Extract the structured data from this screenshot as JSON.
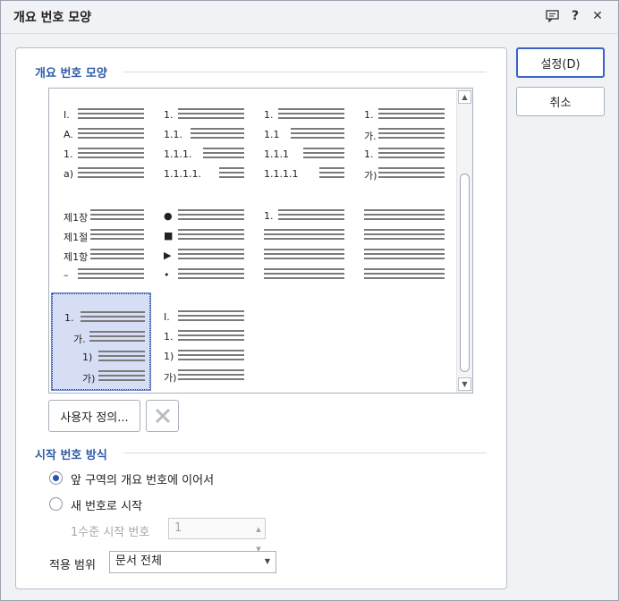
{
  "window": {
    "title": "개요 번호 모양"
  },
  "titlebar_icons": [
    {
      "name": "comment-icon",
      "glyph": "🗨"
    },
    {
      "name": "help-icon",
      "glyph": "?"
    },
    {
      "name": "close-icon",
      "glyph": "✕"
    }
  ],
  "outline_section": {
    "label": "개요 번호 모양"
  },
  "presets": [
    {
      "labels": [
        "I.",
        "A.",
        "1.",
        "a)"
      ]
    },
    {
      "labels": [
        "1.",
        "1.1.",
        "1.1.1.",
        "1.1.1.1."
      ]
    },
    {
      "labels": [
        "1.",
        "1.1",
        "1.1.1",
        "1.1.1.1"
      ]
    },
    {
      "labels": [
        "1.",
        "가.",
        "1.",
        "가)"
      ]
    },
    {
      "labels": [
        "제1장",
        "제1절",
        "제1항",
        "–"
      ]
    },
    {
      "labels": [
        "●",
        "■",
        "▶",
        "•"
      ]
    },
    {
      "labels": [
        "1.",
        "",
        "",
        ""
      ]
    },
    {
      "labels": [
        "",
        "",
        "",
        ""
      ]
    },
    {
      "labels": [
        "1.",
        "가.",
        "1)",
        "가)"
      ],
      "selected": true
    },
    {
      "labels": [
        "I.",
        "1.",
        "1)",
        "가)"
      ]
    }
  ],
  "custom_button": {
    "label": "사용자 정의..."
  },
  "delete_icon": "delete-x-icon",
  "start_section": {
    "label": "시작 번호 방식"
  },
  "radio_continue": {
    "label": "앞 구역의 개요 번호에 이어서",
    "checked": true
  },
  "radio_new": {
    "label": "새 번호로 시작",
    "checked": false
  },
  "start_level": {
    "label": "1수준 시작 번호",
    "value": "1"
  },
  "scope": {
    "label": "적용 범위",
    "value": "문서 전체"
  },
  "buttons": {
    "ok": "설정(D)",
    "cancel": "취소"
  },
  "colors": {
    "accent": "#2754b3",
    "section_label": "#2e5aa8",
    "selection": "#d5def5"
  }
}
